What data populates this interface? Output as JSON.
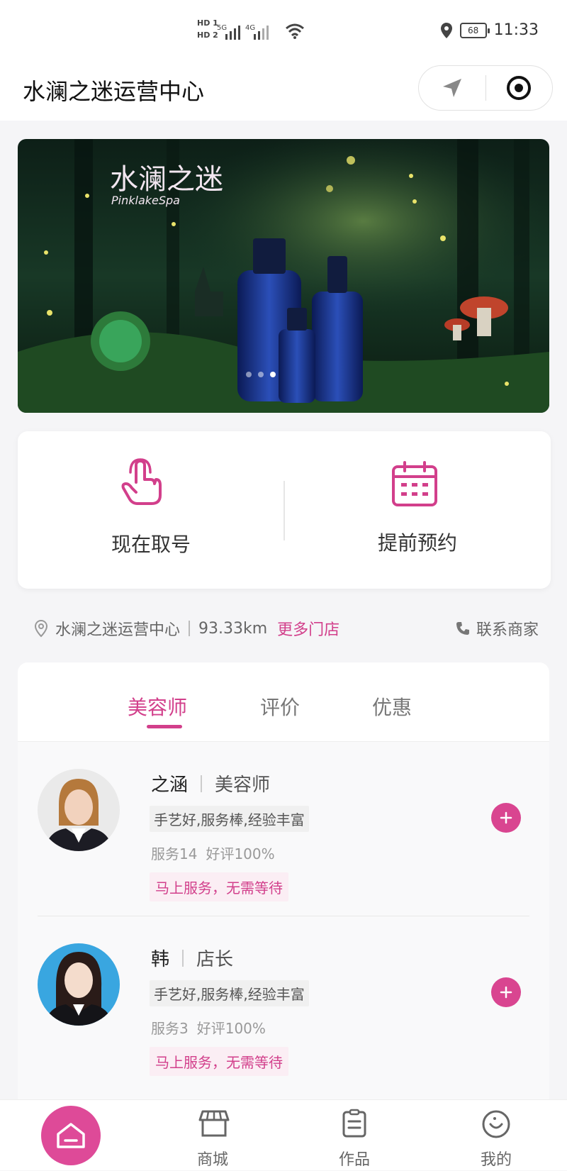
{
  "status_bar": {
    "sim1": "HD 1",
    "sim2": "HD 2",
    "net1": "5G",
    "net2": "4G",
    "battery": "68",
    "time": "11:33"
  },
  "nav": {
    "title": "水澜之迷运营中心"
  },
  "banner": {
    "logo_cn": "水澜之迷",
    "logo_en": "PinklakeSpa",
    "dots_total": 3,
    "dots_active": 2
  },
  "actions": [
    {
      "label": "现在取号",
      "icon": "hand-tap-icon"
    },
    {
      "label": "提前预约",
      "icon": "calendar-icon"
    }
  ],
  "store_info": {
    "name": "水澜之迷运营中心",
    "distance": "93.33km",
    "more_link": "更多门店",
    "contact": "联系商家"
  },
  "tabs": [
    {
      "label": "美容师",
      "active": true
    },
    {
      "label": "评价",
      "active": false
    },
    {
      "label": "优惠",
      "active": false
    }
  ],
  "staff": [
    {
      "name": "之涵",
      "role": "美容师",
      "tag": "手艺好,服务棒,经验丰富",
      "services": "服务14",
      "rating": "好评100%",
      "promo": "马上服务，无需等待"
    },
    {
      "name": "韩",
      "role": "店长",
      "tag": "手艺好,服务棒,经验丰富",
      "services": "服务3",
      "rating": "好评100%",
      "promo": "马上服务，无需等待"
    }
  ],
  "tabbar": [
    {
      "label": "",
      "icon": "home-icon",
      "active": true
    },
    {
      "label": "商城",
      "icon": "store-icon",
      "active": false
    },
    {
      "label": "作品",
      "icon": "document-icon",
      "active": false
    },
    {
      "label": "我的",
      "icon": "user-smile-icon",
      "active": false
    }
  ],
  "colors": {
    "accent": "#d23f8b",
    "background": "#f5f5f7"
  }
}
